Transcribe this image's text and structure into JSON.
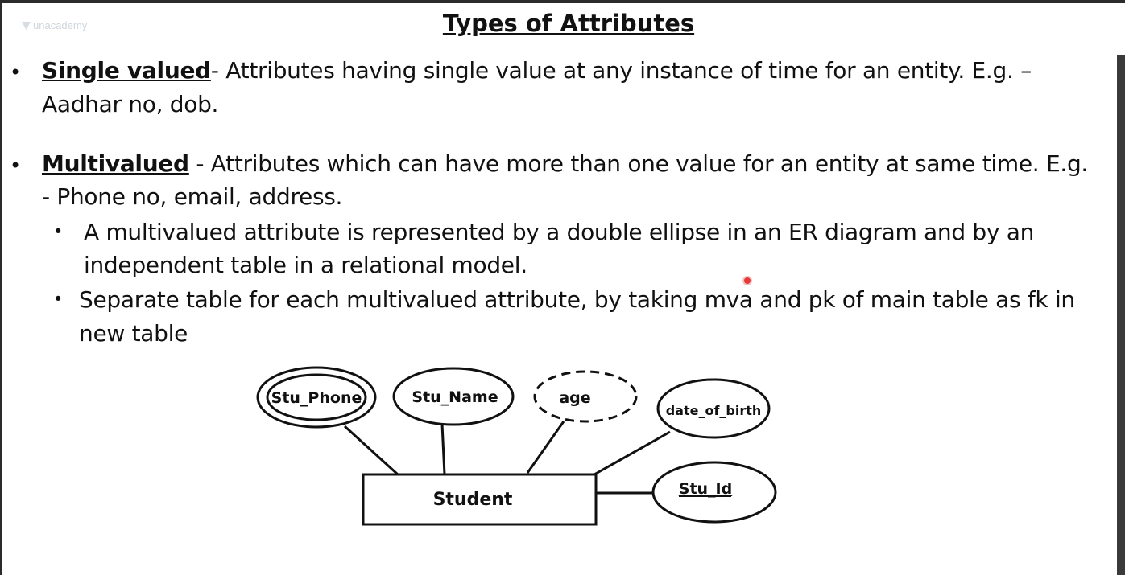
{
  "brand": {
    "logo_text": "unacademy"
  },
  "slide": {
    "title": "Types of Attributes"
  },
  "bullets": [
    {
      "term": "Single valued",
      "text_line1": "- Attributes having single value at any instance of time for an entity. E.g. –",
      "text_line2": "Aadhar no, dob."
    },
    {
      "term": "Multivalued",
      "text_line1": " - Attributes which can have more than one value for an entity at same time.  E.g.",
      "text_line2": "- Phone no, email, address."
    }
  ],
  "sub_bullets": [
    {
      "line1": "A multivalued attribute is represented by a double ellipse in an ER diagram and by an",
      "line2": "independent table in a relational model."
    },
    {
      "line1": "Separate table for each multivalued attribute, by taking mva and pk of main table as fk in",
      "line2": "new table"
    }
  ],
  "er_diagram": {
    "entity": "Student",
    "attributes": {
      "multivalued": "Stu_Phone",
      "simple": "Stu_Name",
      "derived": "age",
      "single": "date_of_birth",
      "key": "Stu_Id"
    }
  }
}
